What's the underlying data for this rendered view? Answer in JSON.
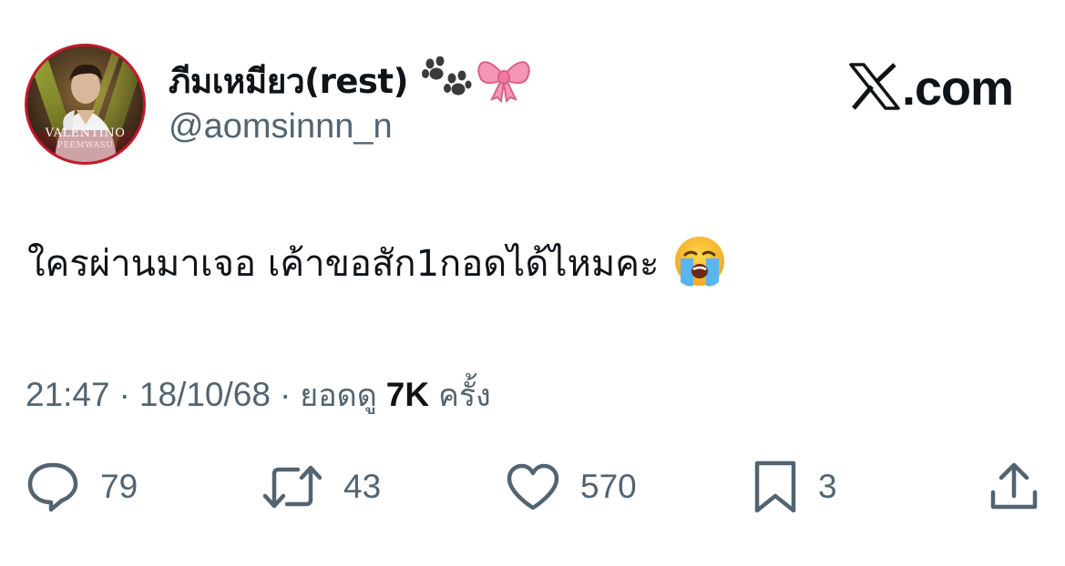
{
  "author": {
    "display_name": "ภีมเหมียว(rest)",
    "name_emojis": [
      "paw-prints-icon",
      "ribbon-icon"
    ],
    "handle": "@aomsinnn_n",
    "avatar": {
      "caption_line1": "VALENTINO",
      "caption_line2": "PEEMWASU",
      "border_color": "#c41a2b"
    }
  },
  "brand": {
    "mark": "𝕏",
    "domain": ".com"
  },
  "tweet": {
    "text": "ใครผ่านมาเจอ เค้าขอสัก1กอดได้ไหมคะ",
    "emoji": "loudly-crying-face-icon"
  },
  "meta": {
    "time": "21:47",
    "separator": "·",
    "date": "18/10/68",
    "views_label": "ยอดดู",
    "views_count": "7K",
    "views_unit": "ครั้ง"
  },
  "actions": {
    "replies": "79",
    "reposts": "43",
    "likes": "570",
    "bookmarks": "3"
  },
  "colors": {
    "text_primary": "#0f1419",
    "text_secondary": "#536471",
    "icon": "#536471"
  }
}
